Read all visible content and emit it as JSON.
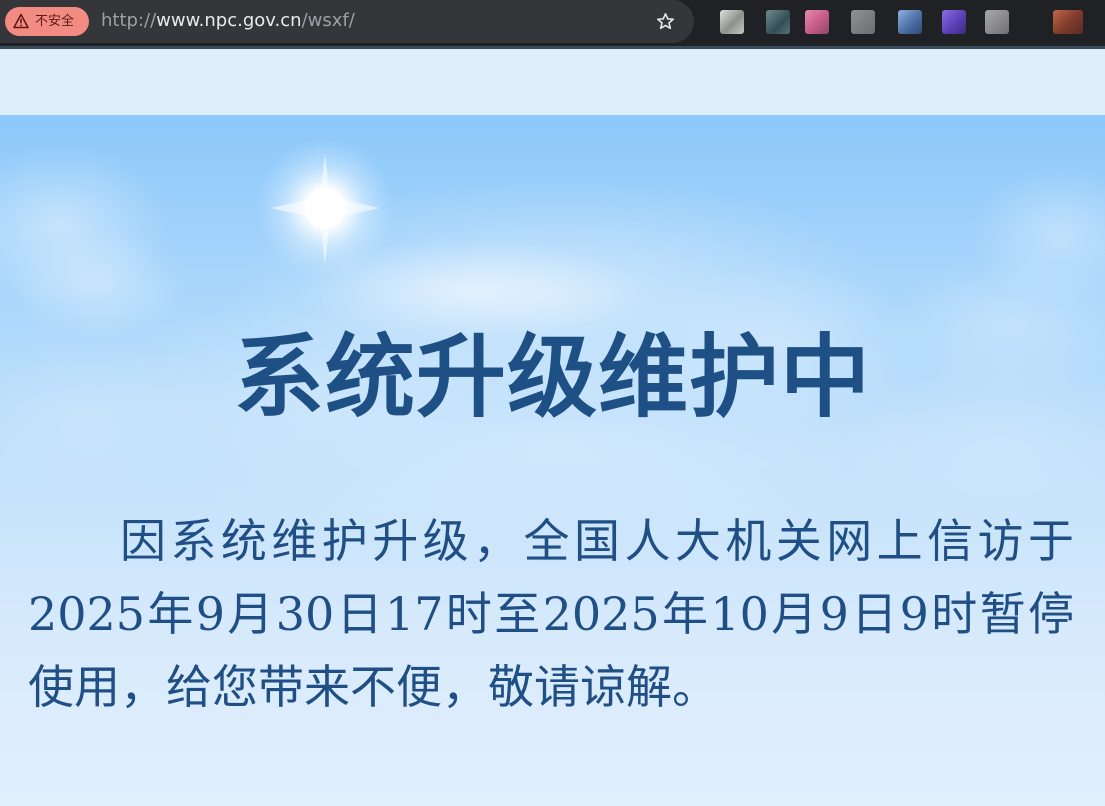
{
  "browser": {
    "security_label": "不安全",
    "url_scheme": "http://",
    "url_host": "www.npc.gov.cn",
    "url_path": "/wsxf/",
    "icons": [
      "warning-icon",
      "bookmark-star-icon"
    ],
    "extension_icon_colors": [
      "#a7aaa5",
      "#4e7076",
      "#d96f97",
      "#7b7d80",
      "#5f7fb0",
      "#6c55c9",
      "#8a8a8e",
      "#a4573e"
    ]
  },
  "notice": {
    "title": "系统升级维护中",
    "body": "因系统维护升级，全国人大机关网上信访于2025年9月30日17时至2025年10月9日9时暂停使用，给您带来不便，敬请谅解。"
  },
  "colors": {
    "title": "#1e4f85",
    "body_text": "#1f4f85",
    "security_chip": "#f28b82",
    "browser_bar": "#202124"
  }
}
